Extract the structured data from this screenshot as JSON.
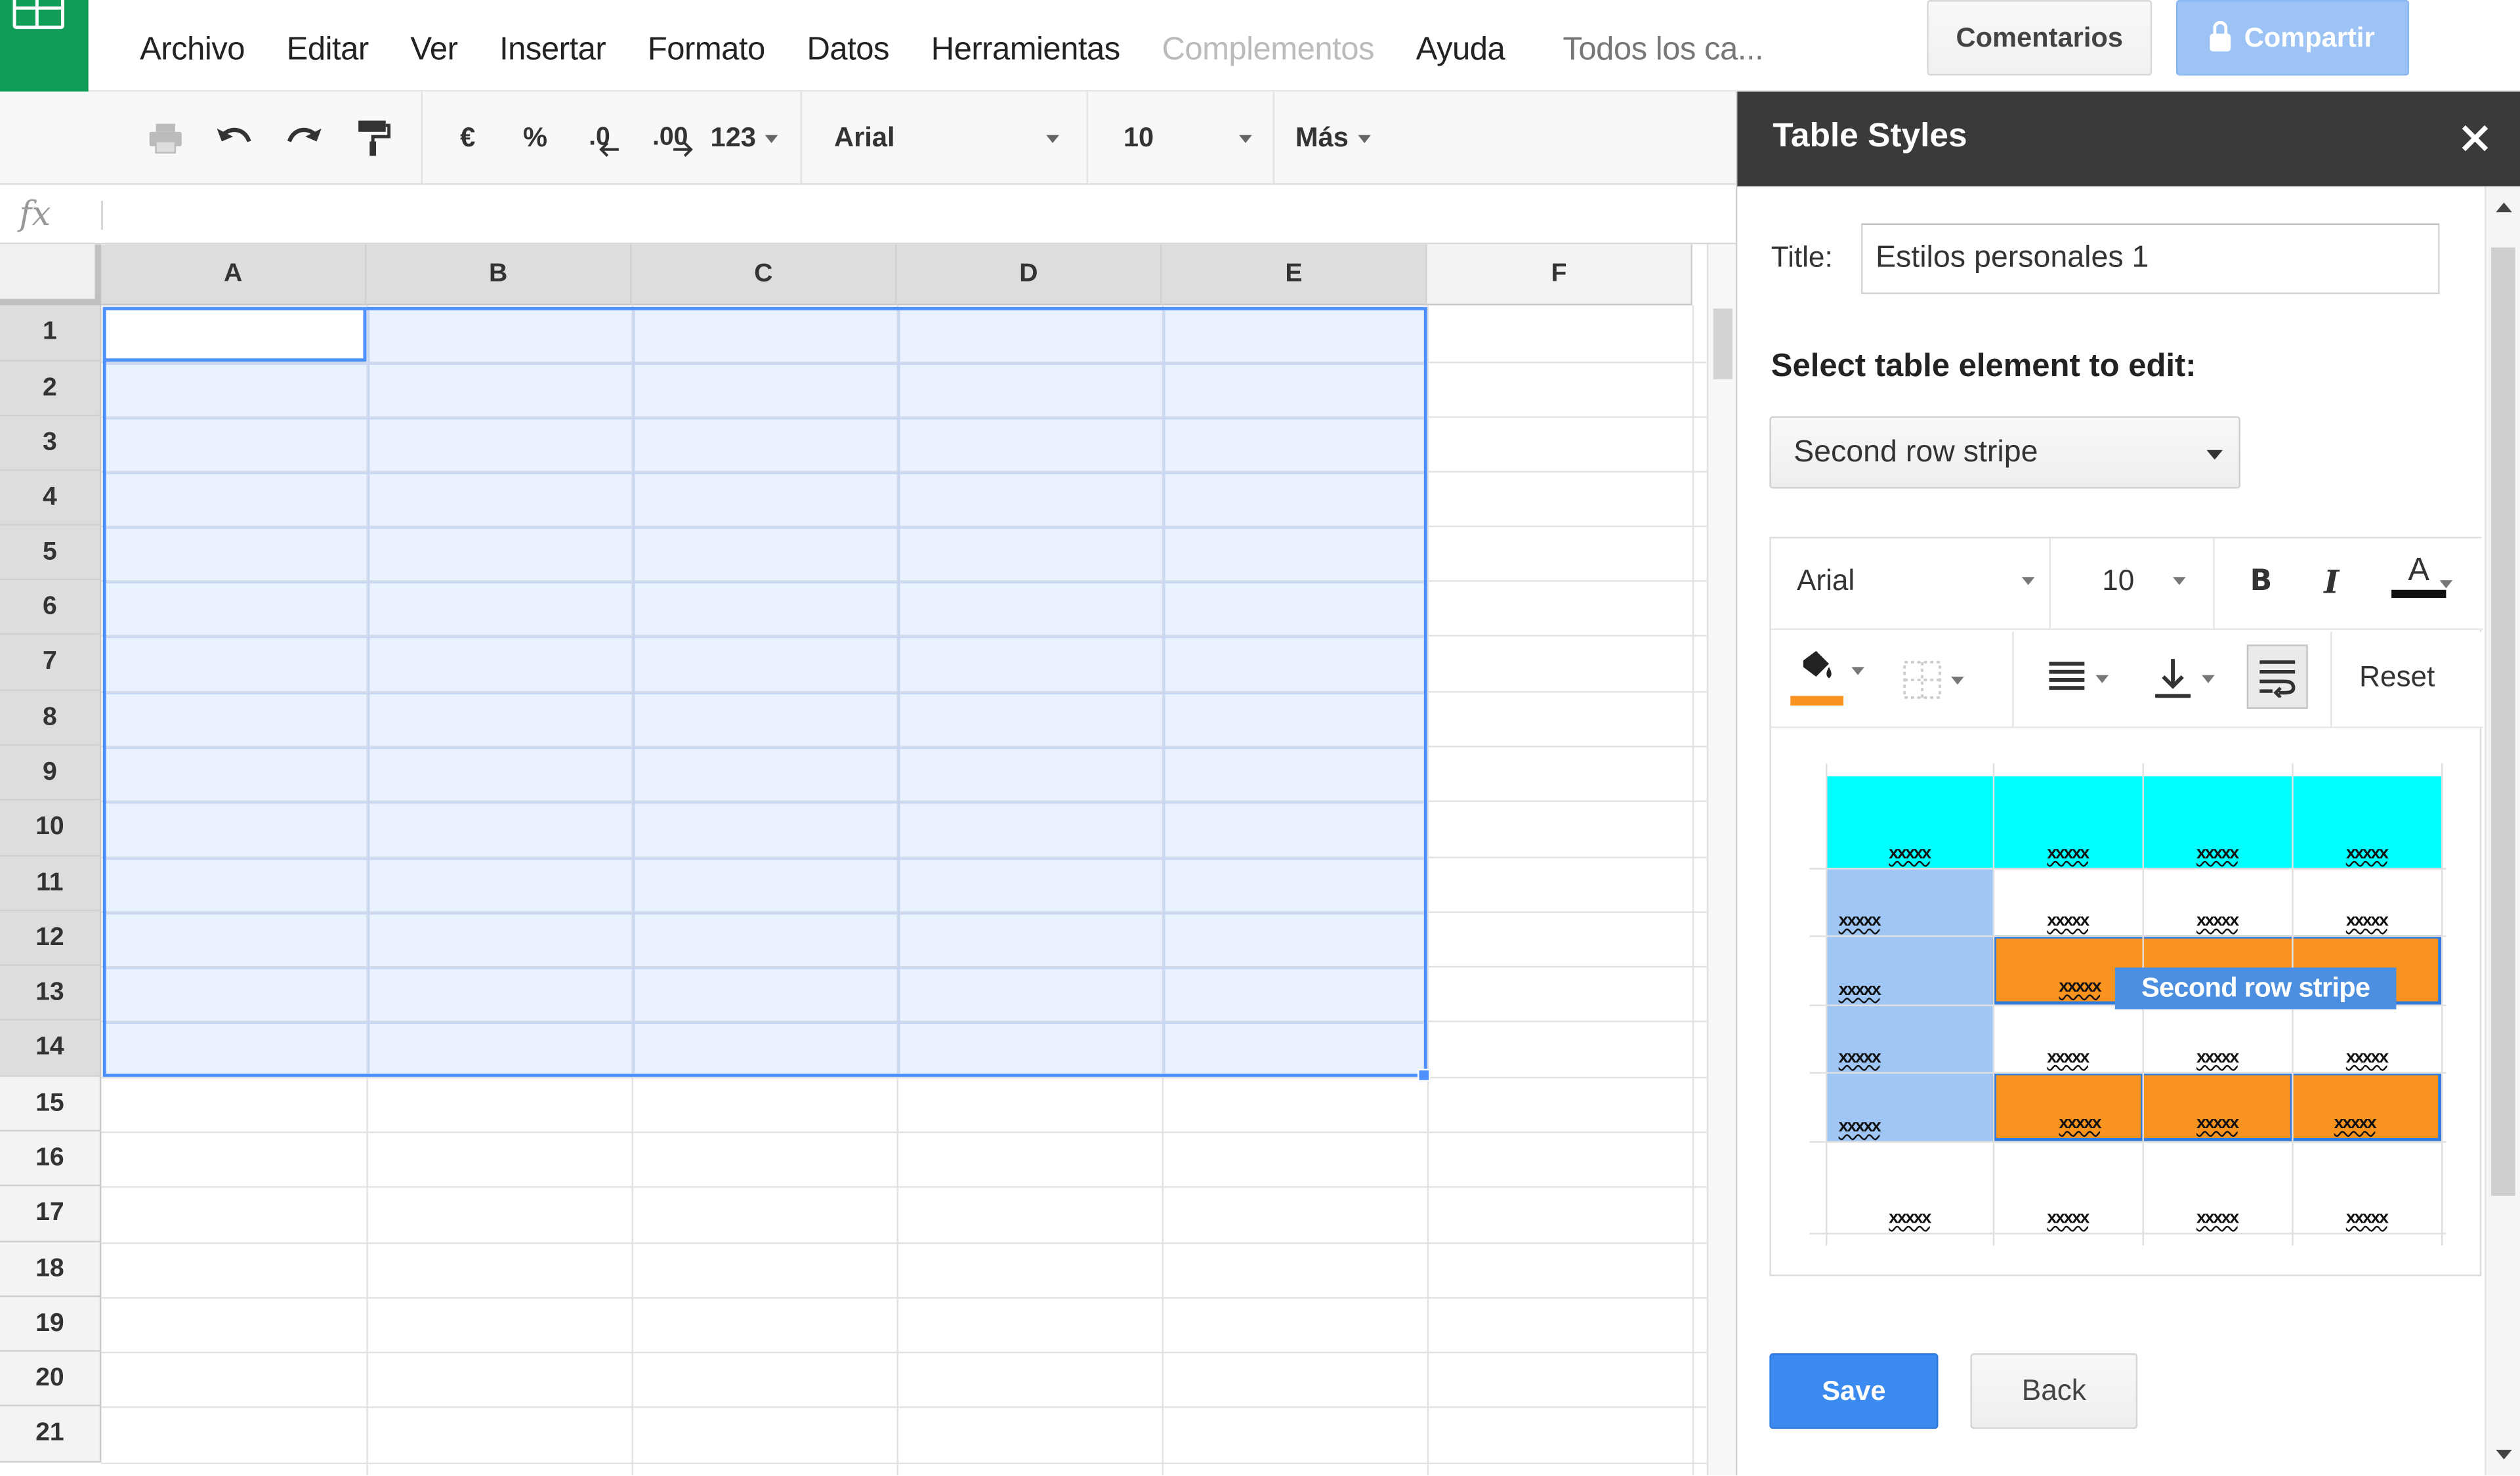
{
  "menubar": {
    "items": [
      "Archivo",
      "Editar",
      "Ver",
      "Insertar",
      "Formato",
      "Datos",
      "Herramientas",
      "Complementos",
      "Ayuda"
    ],
    "hint": "Todos los ca...",
    "comments_label": "Comentarios",
    "share_label": "Compartir"
  },
  "toolbar": {
    "currency": "€",
    "percent": "%",
    "decrease_decimal": ".0",
    "increase_decimal": ".00",
    "number_format": "123",
    "font": "Arial",
    "font_size": "10",
    "more": "Más"
  },
  "formula_bar": {
    "label": "fx",
    "value": ""
  },
  "grid": {
    "columns": [
      "A",
      "B",
      "C",
      "D",
      "E",
      "F"
    ],
    "rows": [
      "1",
      "2",
      "3",
      "4",
      "5",
      "6",
      "7",
      "8",
      "9",
      "10",
      "11",
      "12",
      "13",
      "14",
      "15",
      "16",
      "17",
      "18",
      "19",
      "20",
      "21"
    ],
    "selected_columns": [
      "A",
      "B",
      "C",
      "D",
      "E"
    ],
    "selected_rows": [
      "1",
      "2",
      "3",
      "4",
      "5",
      "6",
      "7",
      "8",
      "9",
      "10",
      "11",
      "12",
      "13",
      "14"
    ]
  },
  "sidebar": {
    "title": "Table Styles",
    "title_label": "Title:",
    "title_value": "Estilos personales 1",
    "select_label": "Select table element to edit:",
    "selected_element": "Second row stripe",
    "editor": {
      "font": "Arial",
      "font_size": "10",
      "bold": "B",
      "italic": "I",
      "text_color_glyph": "A",
      "reset_label": "Reset"
    },
    "preview": {
      "cell_text": "xxxxx",
      "tooltip": "Second row stripe"
    },
    "save_label": "Save",
    "back_label": "Back"
  },
  "colors": {
    "brand_green": "#0f9d58",
    "header_cyan": "#00ffff",
    "first_column_blue": "#9fc6f5",
    "stripe_orange": "#f7931e",
    "selection_blue": "#4d90fe",
    "save_blue": "#3b8af0"
  }
}
